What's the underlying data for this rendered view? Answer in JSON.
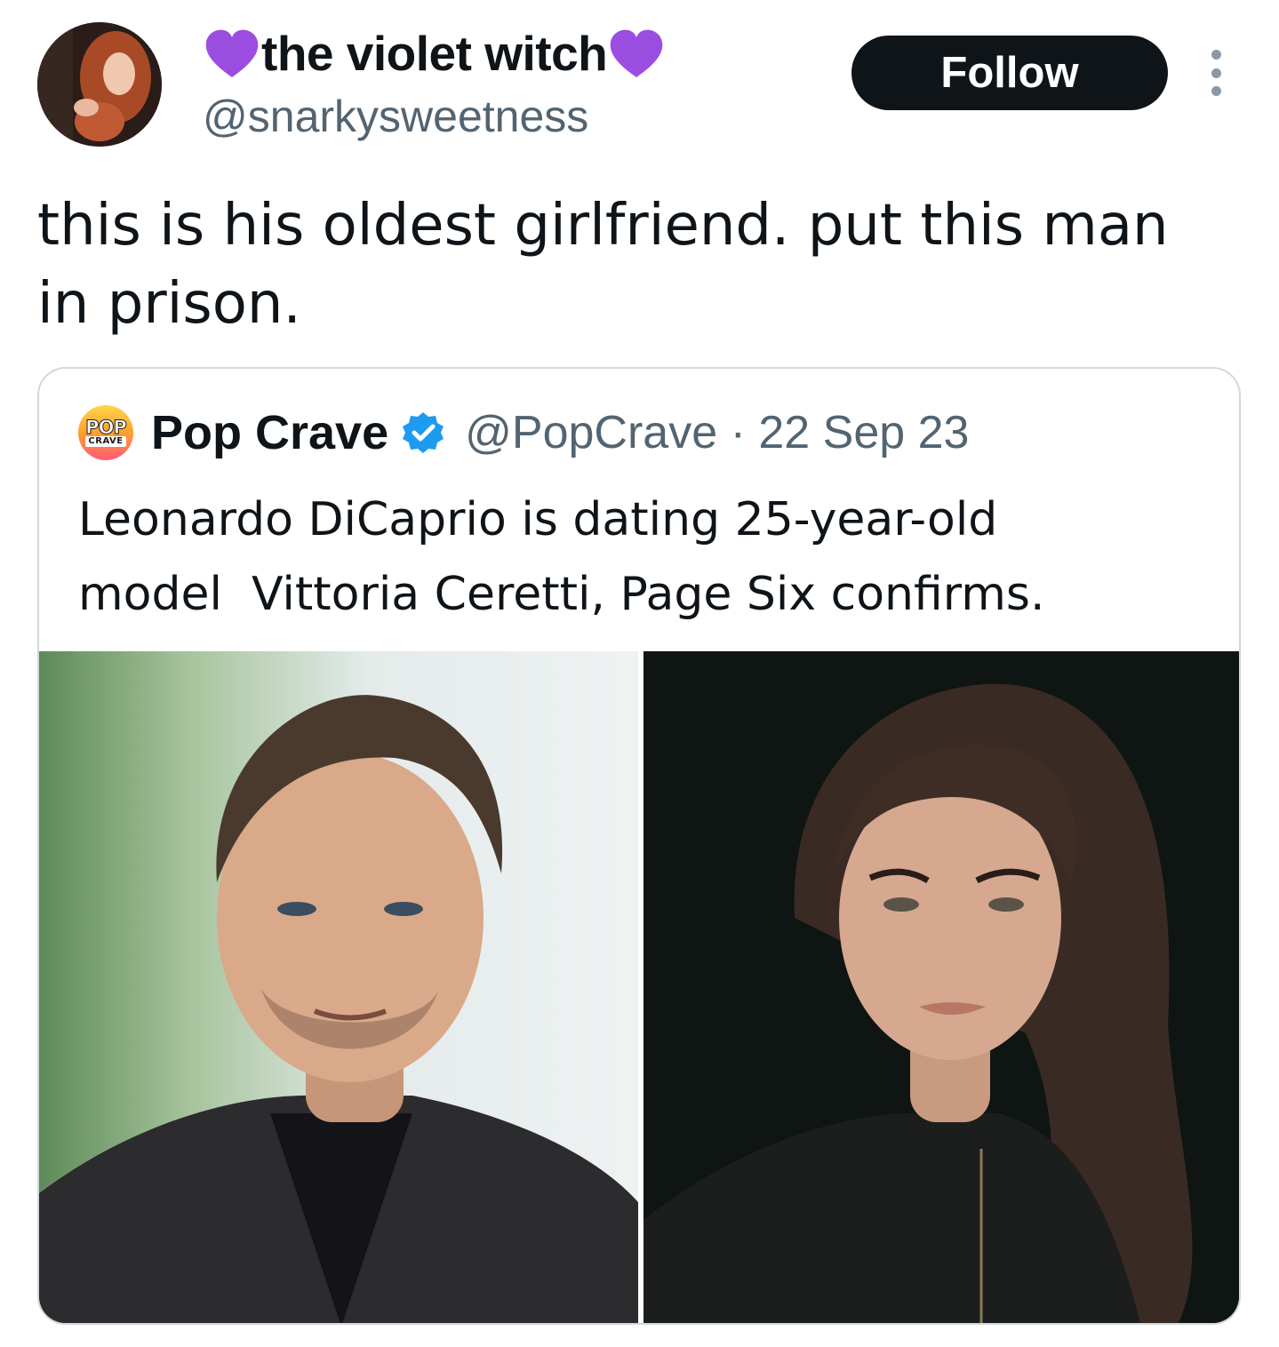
{
  "tweet": {
    "author": {
      "display_name": "the violet witch",
      "handle": "@snarkysweetness",
      "name_emoji": "purple-heart"
    },
    "follow_label": "Follow",
    "text_line1": "this is his oldest girlfriend. put this man",
    "text_line2": "in prison."
  },
  "quoted_tweet": {
    "avatar_text_top": "POP",
    "avatar_text_bottom": "CRAVE",
    "display_name": "Pop Crave",
    "verified": true,
    "handle": "@PopCrave",
    "separator": "·",
    "date": "22 Sep 23",
    "text": "Leonardo DiCaprio is dating 25-year-old\nmodel  Vittoria Ceretti, Page Six confirms.",
    "media": [
      {
        "description_icon": "photo-man-portrait"
      },
      {
        "description_icon": "photo-woman-portrait"
      }
    ]
  },
  "colors": {
    "text_primary": "#0f1419",
    "text_secondary": "#536471",
    "follow_bg": "#0f1419",
    "verified_blue": "#1d9bf0",
    "heart_purple": "#9b4de0",
    "border": "#cfd9de"
  }
}
